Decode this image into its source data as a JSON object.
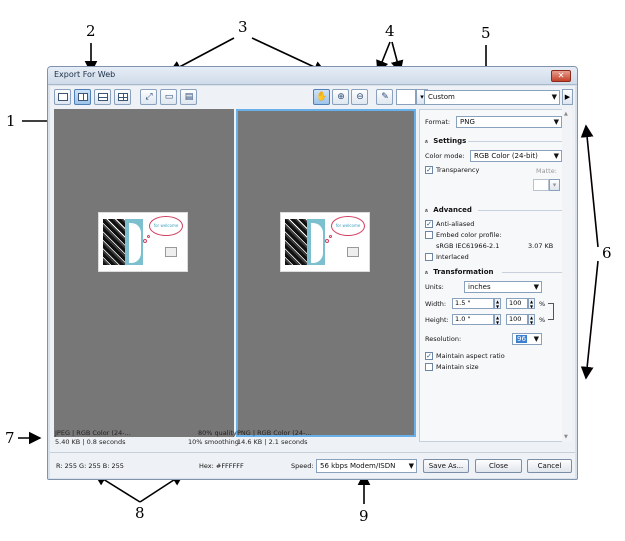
{
  "window": {
    "title": "Export For Web",
    "close_glyph": "✕"
  },
  "callouts": [
    "1",
    "2",
    "3",
    "4",
    "5",
    "6",
    "7",
    "8",
    "9"
  ],
  "toolbar": {
    "view_icons": [
      "single-view-icon",
      "split-vertical-icon",
      "split-horizontal-icon",
      "quad-view-icon",
      "fit-page-icon",
      "actual-size-icon",
      "preview-browser-icon"
    ],
    "tool_icons": [
      "hand-tool-icon",
      "zoom-in-icon",
      "zoom-out-icon",
      "eyedropper-icon"
    ],
    "preset": "Custom"
  },
  "preview": {
    "left": {
      "line1_left": "JPEG  |  RGB Color (24-...",
      "line1_right": "80% quality",
      "line2_left": "5.40 KB  |  0.8 seconds",
      "line2_right": "10% smoothing"
    },
    "right": {
      "line1": "PNG  |  RGB Color (24-...",
      "line2": "14.6 KB  |  2.1 seconds"
    },
    "thumb_text": "for welcome"
  },
  "settings": {
    "format_label": "Format:",
    "format_value": "PNG",
    "settings_header": "Settings",
    "color_mode_label": "Color mode:",
    "color_mode_value": "RGB Color (24-bit)",
    "transparency_label": "Transparency",
    "transparency_checked": "✓",
    "matte_label": "Matte:",
    "advanced_header": "Advanced",
    "anti_aliased_label": "Anti-aliased",
    "anti_aliased_checked": "✓",
    "embed_profile_label": "Embed color profile:",
    "profile_name": "sRGB IEC61966-2.1",
    "profile_size": "3.07 KB",
    "interlaced_label": "Interlaced",
    "transformation_header": "Transformation",
    "units_label": "Units:",
    "units_value": "inches",
    "width_label": "Width:",
    "width_value": "1.5 \"",
    "width_pct": "100",
    "height_label": "Height:",
    "height_value": "1.0 \"",
    "height_pct": "100",
    "pct_symbol": "%",
    "resolution_label": "Resolution:",
    "resolution_value": "96",
    "maintain_ratio_label": "Maintain aspect ratio",
    "maintain_ratio_checked": "✓",
    "maintain_size_label": "Maintain size"
  },
  "status": {
    "rgb": "R: 255  G: 255  B: 255",
    "hex": "Hex: #FFFFFF",
    "speed_label": "Speed:",
    "speed_value": "56 kbps Modem/ISDN",
    "save_as": "Save As...",
    "close": "Close",
    "cancel": "Cancel"
  }
}
